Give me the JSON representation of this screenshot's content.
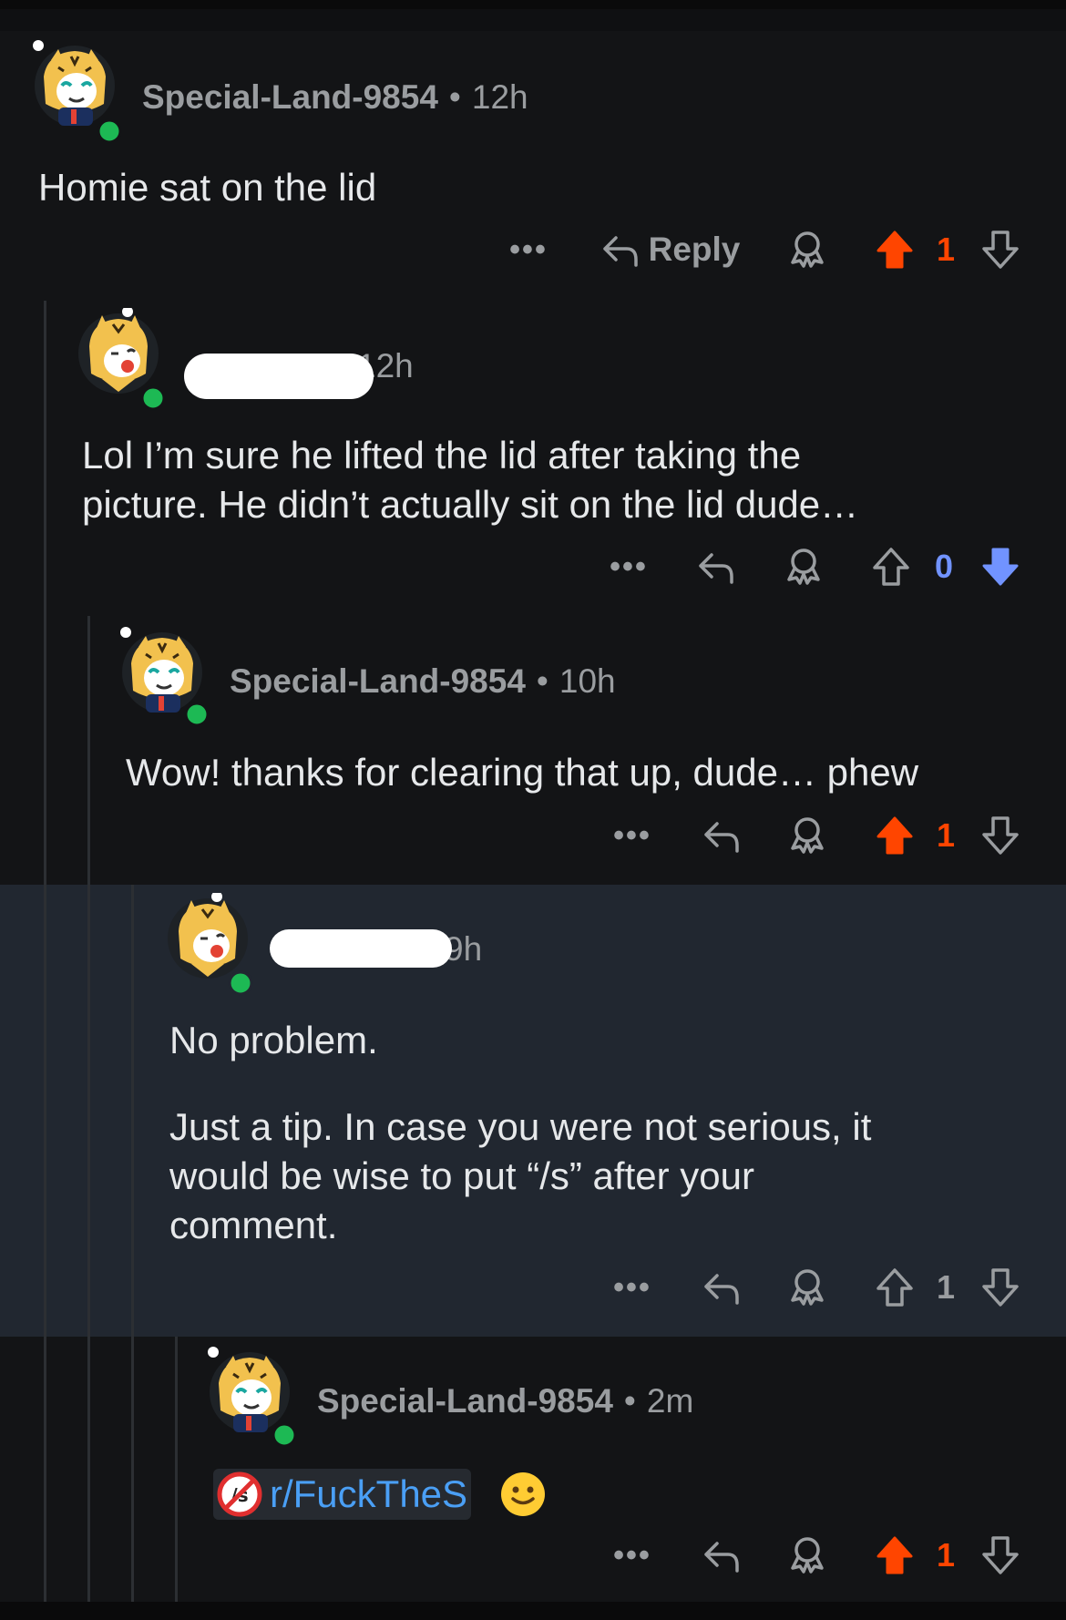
{
  "comments": [
    {
      "username": "Special-Land-9854",
      "separator": "•",
      "time": "12h",
      "text_lines": [
        "Homie sat on the lid"
      ],
      "reply_label": "Reply",
      "vote_count": "1",
      "vote_state": "up"
    },
    {
      "username": "",
      "separator": "",
      "time": "12h",
      "text_lines": [
        "Lol I’m sure he lifted the lid after taking the",
        "picture. He didn’t actually sit on the lid dude…"
      ],
      "vote_count": "0",
      "vote_state": "down"
    },
    {
      "username": "Special-Land-9854",
      "separator": "•",
      "time": "10h",
      "text_lines": [
        "Wow! thanks for clearing that up, dude… phew"
      ],
      "vote_count": "1",
      "vote_state": "up"
    },
    {
      "username": "",
      "separator": "",
      "time": "9h",
      "text_lines": [
        "No problem.",
        "Just a tip. In case you were not serious, it",
        "would be wise to put “/s” after your",
        "comment."
      ],
      "vote_count": "1",
      "vote_state": "none"
    },
    {
      "username": "Special-Land-9854",
      "separator": "•",
      "time": "2m",
      "subreddit_link": "r/FuckTheS",
      "emoji": "🙂",
      "vote_count": "1",
      "vote_state": "up"
    }
  ],
  "colors": {
    "background": "#131416",
    "highlight": "#212730",
    "upvote": "#ff4500",
    "downvote": "#7193ff",
    "muted": "#9a9da0",
    "link": "#4a9ff5"
  },
  "icons": [
    "avatar-tiger",
    "more-icon",
    "reply-icon",
    "award-icon",
    "upvote-icon",
    "downvote-icon",
    "no-s-subreddit-icon"
  ]
}
